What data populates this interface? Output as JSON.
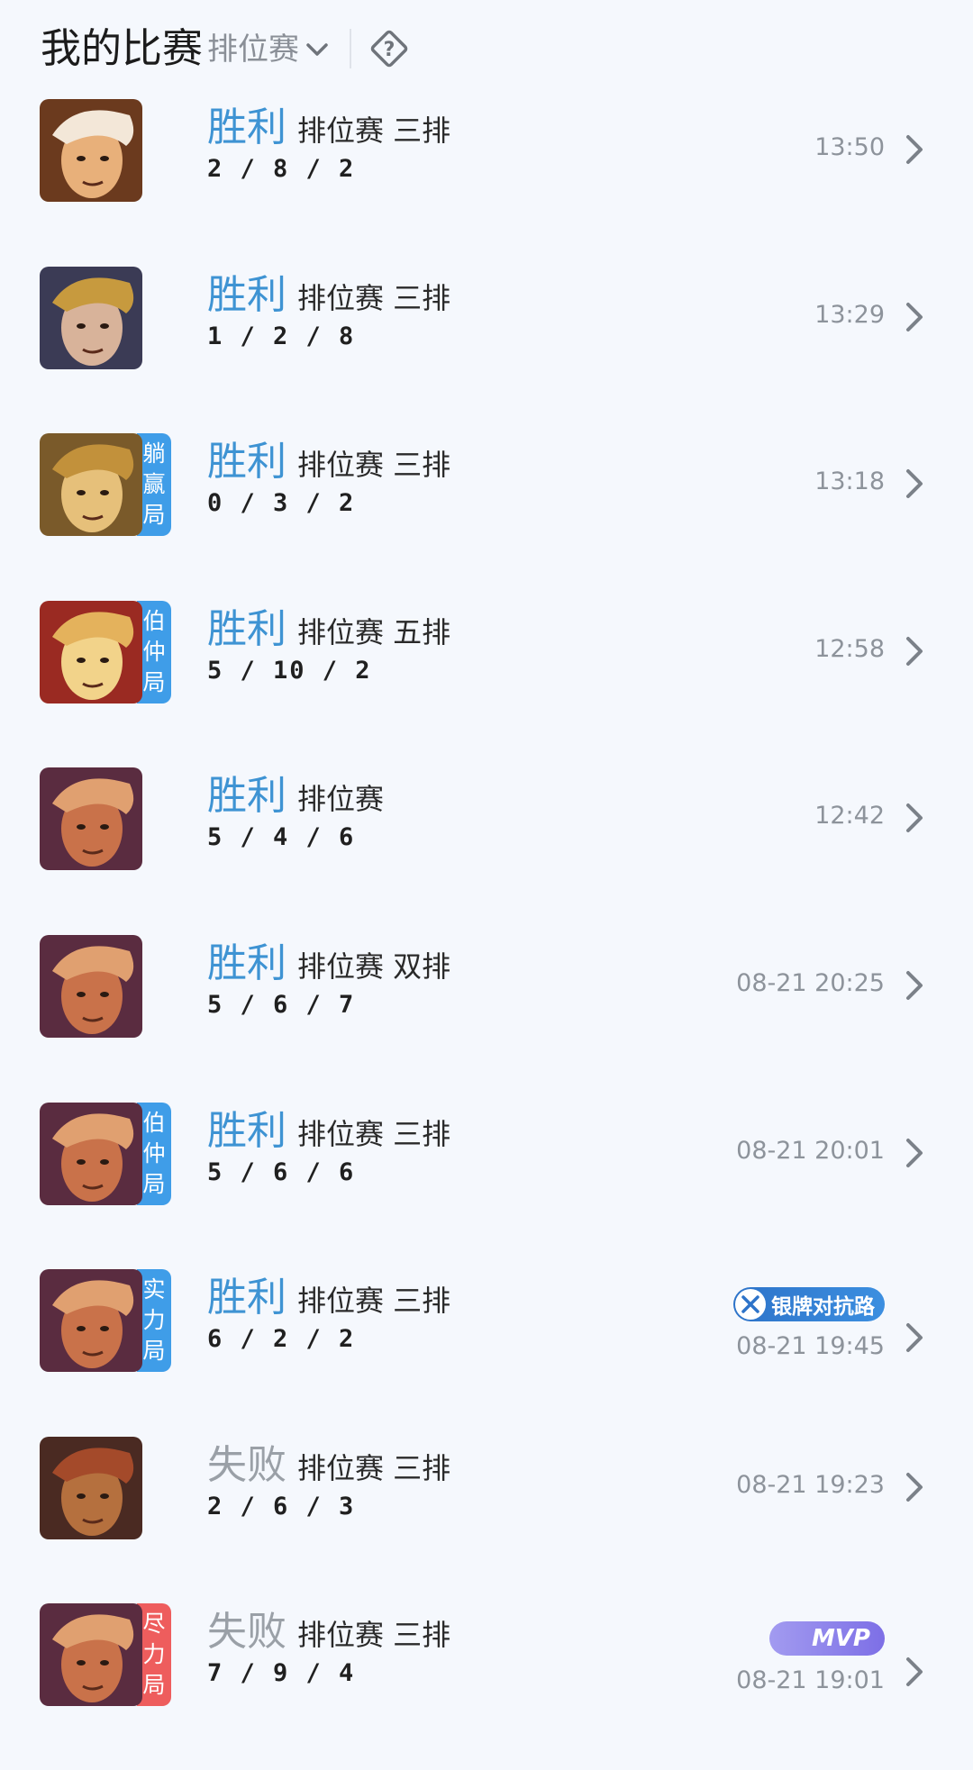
{
  "header": {
    "title": "我的比赛",
    "filter_label": "排位赛"
  },
  "matches": [
    {
      "result": "胜利",
      "mode": "排位赛 三排",
      "kda": "2 / 8 / 2",
      "time": "13:50",
      "tag": []
    },
    {
      "result": "胜利",
      "mode": "排位赛 三排",
      "kda": "1 / 2 / 8",
      "time": "13:29",
      "tag": []
    },
    {
      "result": "胜利",
      "mode": "排位赛 三排",
      "kda": "0 / 3 / 2",
      "time": "13:18",
      "tag": [
        "躺",
        "赢",
        "局"
      ]
    },
    {
      "result": "胜利",
      "mode": "排位赛 五排",
      "kda": "5 / 10 / 2",
      "time": "12:58",
      "tag": [
        "伯",
        "仲",
        "局"
      ]
    },
    {
      "result": "胜利",
      "mode": "排位赛",
      "kda": "5 / 4 / 6",
      "time": "12:42",
      "tag": []
    },
    {
      "result": "胜利",
      "mode": "排位赛 双排",
      "kda": "5 / 6 / 7",
      "time": "08-21 20:25",
      "tag": []
    },
    {
      "result": "胜利",
      "mode": "排位赛 三排",
      "kda": "5 / 6 / 6",
      "time": "08-21 20:01",
      "tag": [
        "伯",
        "仲",
        "局"
      ]
    },
    {
      "result": "胜利",
      "mode": "排位赛 三排",
      "kda": "6 / 2 / 2",
      "time": "08-21 19:45",
      "tag": [
        "实",
        "力",
        "局"
      ],
      "badge": "银牌对抗路"
    },
    {
      "result": "失败",
      "mode": "排位赛 三排",
      "kda": "2 / 6 / 3",
      "time": "08-21 19:23",
      "tag": []
    },
    {
      "result": "失败",
      "mode": "排位赛 三排",
      "kda": "7 / 9 / 4",
      "time": "08-21 19:01",
      "tag": [
        "尽",
        "力",
        "局"
      ],
      "badge": "MVP"
    }
  ],
  "colors": {
    "win": "#3e93d3",
    "lose": "#9aa0a7",
    "tag_blue": "#3f9de8",
    "tag_red": "#ee5d5d"
  }
}
